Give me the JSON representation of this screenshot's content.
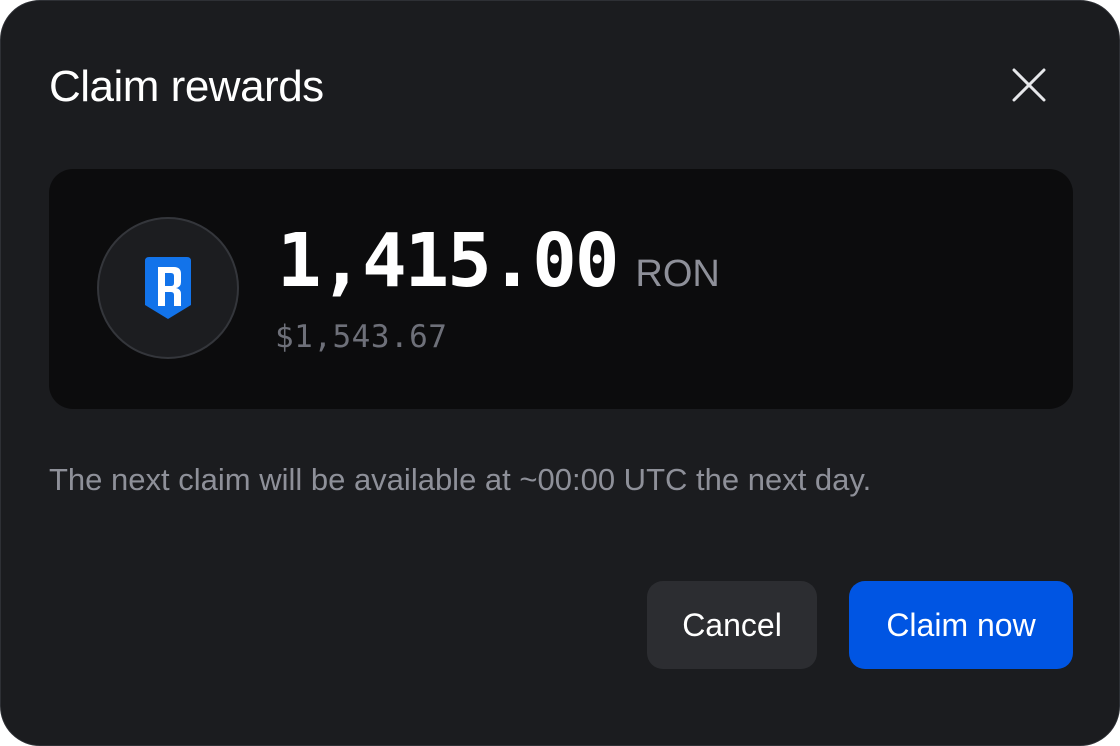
{
  "dialog": {
    "title": "Claim rewards",
    "close_icon": "close-icon"
  },
  "reward": {
    "token_icon": "ronin-logo-icon",
    "amount": "1,415.00",
    "unit": "RON",
    "fiat_value": "$1,543.67"
  },
  "note": "The next claim will be available at ~00:00 UTC the next day.",
  "actions": {
    "cancel_label": "Cancel",
    "claim_label": "Claim now"
  },
  "colors": {
    "background": "#1b1c1f",
    "card": "#0c0c0d",
    "primary": "#0055e3",
    "secondary_button": "#2c2d31",
    "muted_text": "#8e9099"
  }
}
